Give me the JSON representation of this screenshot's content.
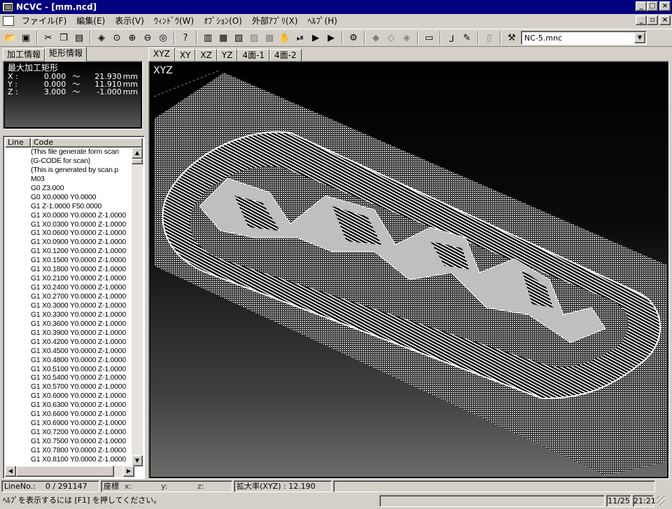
{
  "window": {
    "title": "NCVC - [mm.ncd]"
  },
  "menu": [
    "ファイル(F)",
    "編集(E)",
    "表示(V)",
    "ｳｨﾝﾄﾞｳ(W)",
    "ｵﾌﾟｼｮﾝ(O)",
    "外部ｱﾌﾟﾘ(X)",
    "ﾍﾙﾌﾟ(H)"
  ],
  "toolbar": {
    "machine_file": "NC-5.mnc"
  },
  "left_tabs": [
    "加工情報",
    "矩形情報"
  ],
  "info": {
    "heading": "最大加工矩形",
    "rows": [
      {
        "axis": "X :",
        "from": "0.000",
        "tilde": "〜",
        "to": "21.930",
        "unit": "mm"
      },
      {
        "axis": "Y :",
        "from": "0.000",
        "tilde": "〜",
        "to": "11.910",
        "unit": "mm"
      },
      {
        "axis": "Z :",
        "from": "3.000",
        "tilde": "〜",
        "to": "-1.000",
        "unit": "mm"
      }
    ]
  },
  "code_list": {
    "headers": {
      "line": "Line",
      "code": "Code"
    },
    "rows": [
      "(This file generate form scan",
      "(G-CODE for scan)",
      "(This is generated by scan.p",
      "M03",
      "G0 Z3.000",
      "G0 X0.0000 Y0.0000",
      "G1 Z-1.0000 F50.0000",
      "G1 X0.0000 Y0.0000 Z-1.0000",
      "G1 X0.0300 Y0.0000 Z-1.0000",
      "G1 X0.0600 Y0.0000 Z-1.0000",
      "G1 X0.0900 Y0.0000 Z-1.0000",
      "G1 X0.1200 Y0.0000 Z-1.0000",
      "G1 X0.1500 Y0.0000 Z-1.0000",
      "G1 X0.1800 Y0.0000 Z-1.0000",
      "G1 X0.2100 Y0.0000 Z-1.0000",
      "G1 X0.2400 Y0.0000 Z-1.0000",
      "G1 X0.2700 Y0.0000 Z-1.0000",
      "G1 X0.3000 Y0.0000 Z-1.0000",
      "G1 X0.3300 Y0.0000 Z-1.0000",
      "G1 X0.3600 Y0.0000 Z-1.0000",
      "G1 X0.3900 Y0.0000 Z-1.0000",
      "G1 X0.4200 Y0.0000 Z-1.0000",
      "G1 X0.4500 Y0.0000 Z-1.0000",
      "G1 X0.4800 Y0.0000 Z-1.0000",
      "G1 X0.5100 Y0.0000 Z-1.0000",
      "G1 X0.5400 Y0.0000 Z-1.0000",
      "G1 X0.5700 Y0.0000 Z-1.0000",
      "G1 X0.6000 Y0.0000 Z-1.0000",
      "G1 X0.6300 Y0.0000 Z-1.0000",
      "G1 X0.6600 Y0.0000 Z-1.0000",
      "G1 X0.6900 Y0.0000 Z-1.0000",
      "G1 X0.7200 Y0.0000 Z-1.0000",
      "G1 X0.7500 Y0.0000 Z-1.0000",
      "G1 X0.7800 Y0.0000 Z-1.0000",
      "G1 X0.8100 Y0.0000 Z-1.0000"
    ]
  },
  "view_tabs": [
    "XYZ",
    "XY",
    "XZ",
    "YZ",
    "4面-1",
    "4面-2"
  ],
  "viewport": {
    "label": "XYZ"
  },
  "status": {
    "line_label": "LineNo.:",
    "line_value": "0 / 291147",
    "coord_label": "座標",
    "x_label": "x:",
    "y_label": "y:",
    "z_label": "z:",
    "zoom": "拡大率(XYZ) : 12.190",
    "help": "ﾍﾙﾌﾟを表示するには [F1] を押してください。",
    "date": "11/25",
    "time": "21:21"
  }
}
